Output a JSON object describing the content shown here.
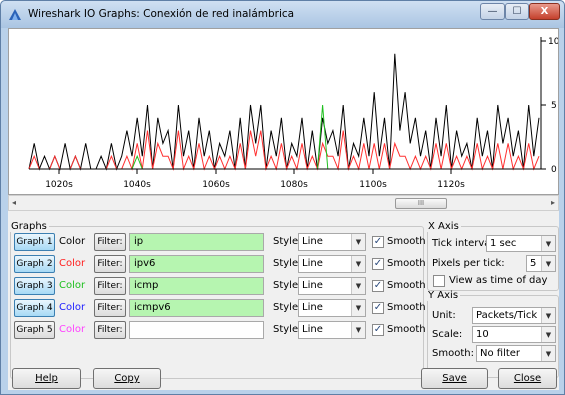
{
  "window": {
    "title": "Wireshark IO Graphs: Conexión de red inalámbrica",
    "min_label": "—",
    "max_label": "☐",
    "close_label": "X"
  },
  "plot": {
    "y_ticks": [
      "10",
      "5",
      "0"
    ],
    "x_ticks": [
      "1020s",
      "1040s",
      "1060s",
      "1080s",
      "1100s",
      "1120s"
    ],
    "scroll_thumb": "III"
  },
  "chart_data": {
    "type": "line",
    "x_ticks": [
      "1020s",
      "1040s",
      "1060s",
      "1080s",
      "1100s",
      "1120s"
    ],
    "ylim": [
      0,
      10
    ],
    "y_ticks": [
      0,
      5,
      10
    ],
    "series": [
      {
        "color": "#000000",
        "values": [
          0,
          2,
          0,
          1,
          0,
          1,
          0,
          2,
          0,
          1,
          0,
          2,
          0,
          0,
          1,
          0,
          2,
          0,
          1,
          3,
          1,
          4,
          1,
          5,
          0,
          4,
          2,
          3,
          0,
          5,
          1,
          3,
          0,
          4,
          1,
          3,
          0,
          2,
          1,
          3,
          0,
          4,
          0,
          5,
          2,
          5,
          0,
          3,
          1,
          4,
          0,
          2,
          1,
          4,
          0,
          3,
          0,
          4,
          2,
          3,
          1,
          5,
          0,
          2,
          1,
          4,
          1,
          6,
          1,
          4,
          0,
          9,
          3,
          6,
          2,
          4,
          1,
          3,
          0,
          4,
          1,
          5,
          0,
          3,
          1,
          2,
          0,
          4,
          1,
          3,
          0,
          5,
          2,
          4,
          1,
          3,
          0,
          5,
          1,
          4
        ]
      },
      {
        "color": "#ff3030",
        "values": [
          0,
          1,
          0,
          0,
          0,
          1,
          0,
          0,
          0,
          1,
          0,
          0,
          0,
          0,
          0,
          0,
          1,
          0,
          0,
          1,
          0,
          2,
          0,
          3,
          0,
          2,
          1,
          1,
          0,
          3,
          0,
          1,
          0,
          2,
          0,
          1,
          0,
          1,
          0,
          1,
          0,
          2,
          0,
          3,
          1,
          3,
          0,
          1,
          0,
          2,
          0,
          1,
          0,
          2,
          0,
          1,
          0,
          2,
          1,
          1,
          0,
          3,
          0,
          1,
          0,
          2,
          0,
          2,
          0,
          2,
          0,
          2,
          1,
          1,
          0,
          1,
          0,
          1,
          0,
          2,
          0,
          2,
          0,
          1,
          0,
          1,
          0,
          2,
          0,
          1,
          0,
          2,
          0,
          2,
          0,
          1,
          0,
          2,
          0,
          1
        ]
      },
      {
        "color": "#20c020",
        "values": [
          0,
          0,
          0,
          0,
          0,
          0,
          0,
          0,
          0,
          0,
          0,
          0,
          0,
          0,
          0,
          0,
          0,
          0,
          0,
          0,
          0,
          1,
          0,
          0,
          0,
          0,
          0,
          0,
          0,
          0,
          0,
          0,
          0,
          0,
          0,
          0,
          0,
          0,
          0,
          0,
          0,
          0,
          0,
          0,
          0,
          0,
          0,
          0,
          0,
          0,
          0,
          0,
          0,
          0,
          0,
          0,
          0,
          5,
          0,
          0,
          0,
          0,
          0,
          0,
          0,
          0,
          0,
          0,
          0,
          0,
          0,
          0,
          0,
          0,
          0,
          0,
          0,
          0,
          0,
          0,
          0,
          0,
          0,
          0,
          0,
          0,
          0,
          0,
          0,
          0,
          0,
          0,
          0,
          0,
          0,
          0,
          0,
          0,
          0,
          0
        ]
      },
      {
        "color": "#3030ff",
        "values": [
          0,
          0,
          0,
          0,
          0,
          0,
          0,
          0,
          0,
          0,
          0,
          0,
          0,
          0,
          0,
          0,
          0,
          0,
          0,
          0,
          0,
          0,
          0,
          0,
          0,
          0,
          0,
          0,
          0,
          0,
          0,
          0,
          0,
          0,
          0,
          0,
          0,
          0,
          0,
          0,
          0,
          0,
          0,
          0,
          0,
          0,
          0,
          0,
          0,
          0,
          0,
          0,
          0,
          0,
          0,
          0,
          0,
          0,
          0,
          0,
          0,
          0,
          0,
          0,
          0,
          0,
          0,
          0,
          0,
          0,
          0,
          0,
          0,
          0,
          0,
          0,
          0,
          0,
          0,
          0,
          0,
          0,
          0,
          0,
          0,
          0,
          0,
          0,
          0,
          0,
          0,
          0,
          0,
          0,
          0,
          0,
          0,
          0,
          0,
          0
        ]
      }
    ]
  },
  "graphs": {
    "legend": "Graphs",
    "color_word": "Color",
    "filter_label": "Filter:",
    "style_label": "Style:",
    "smooth_label": "Smooth",
    "rows": [
      {
        "button": "Graph 1",
        "color": "#000000",
        "filter": "ip",
        "style": "Line",
        "filter_bg": "#b6f5b0",
        "smooth": "✓",
        "active": true
      },
      {
        "button": "Graph 2",
        "color": "#ff2020",
        "filter": "ipv6",
        "style": "Line",
        "filter_bg": "#b6f5b0",
        "smooth": "✓",
        "active": true
      },
      {
        "button": "Graph 3",
        "color": "#20c020",
        "filter": "icmp",
        "style": "Line",
        "filter_bg": "#b6f5b0",
        "smooth": "✓",
        "active": true
      },
      {
        "button": "Graph 4",
        "color": "#2020ff",
        "filter": "icmpv6",
        "style": "Line",
        "filter_bg": "#b6f5b0",
        "smooth": "✓",
        "active": true
      },
      {
        "button": "Graph 5",
        "color": "#ff40ff",
        "filter": "",
        "style": "Line",
        "filter_bg": "#ffffff",
        "smooth": "✓",
        "active": false
      }
    ]
  },
  "x_axis": {
    "legend": "X Axis",
    "tick_interval_label": "Tick interval:",
    "tick_interval_value": "1 sec",
    "pixels_per_tick_label": "Pixels per tick:",
    "pixels_per_tick_value": "5",
    "view_as_time_label": "View as time of day"
  },
  "y_axis": {
    "legend": "Y Axis",
    "unit_label": "Unit:",
    "unit_value": "Packets/Tick",
    "scale_label": "Scale:",
    "scale_value": "10",
    "smooth_label": "Smooth:",
    "smooth_value": "No filter"
  },
  "buttons": {
    "help": "Help",
    "copy": "Copy",
    "save": "Save",
    "close": "Close"
  }
}
